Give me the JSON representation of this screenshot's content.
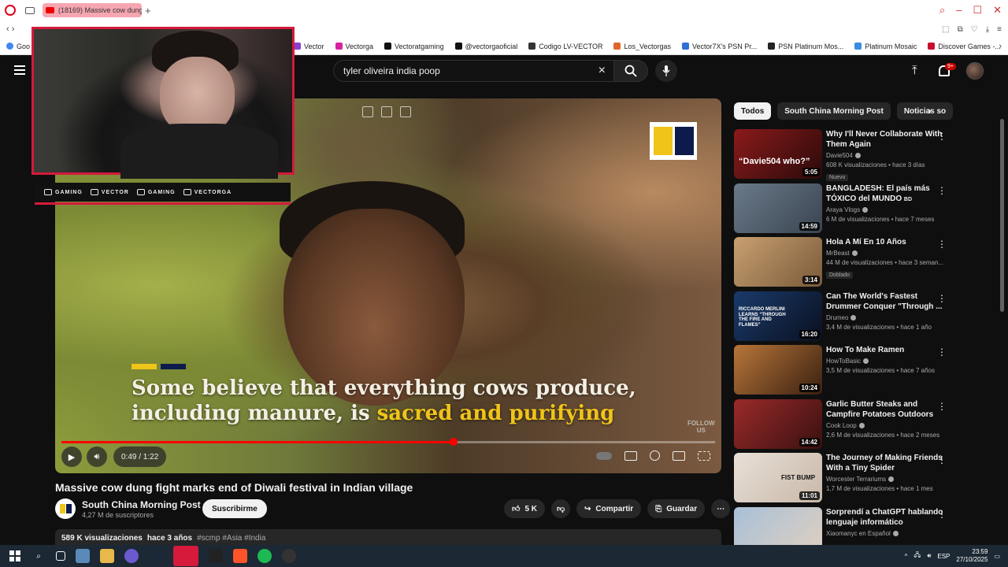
{
  "browser": {
    "tab_title": "(18169) Massive cow dung...",
    "bookmarks_first": "Goo",
    "bookmarks": [
      {
        "label": "Vector",
        "color": "#8a3fd1"
      },
      {
        "label": "Vectorga",
        "color": "#d6249f"
      },
      {
        "label": "Vectoratgaming",
        "color": "#111111"
      },
      {
        "label": "@vectorgaoficial",
        "color": "#111111"
      },
      {
        "label": "Codigo LV-VECTOR",
        "color": "#333333"
      },
      {
        "label": "Los_Vectorgas",
        "color": "#e0652a"
      },
      {
        "label": "Vector7X's PSN Pr...",
        "color": "#2f6fd6"
      },
      {
        "label": "PSN Platinum Mos...",
        "color": "#222222"
      },
      {
        "label": "Platinum Mosaic",
        "color": "#3a8de0"
      },
      {
        "label": "Discover Games -...",
        "color": "#c8102e"
      }
    ]
  },
  "youtube": {
    "search_query": "tyler oliveira india poop",
    "notification_count": "9+",
    "video": {
      "caption_line1": "Some believe that everything cows produce,",
      "caption_line2_a": "including manure, is ",
      "caption_line2_b": "sacred and purifying",
      "follow_text_1": "FOLLOW",
      "follow_text_2": "US",
      "time": "0:49 / 1:22",
      "progress": 0.6
    },
    "title": "Massive cow dung fight marks end of Diwali festival in Indian village",
    "channel": "South China Morning Post",
    "subscribers": "4,27 M de suscriptores",
    "subscribe_label": "Suscribirme",
    "likes": "5 K",
    "share_label": "Compartir",
    "save_label": "Guardar",
    "views": "589 K visualizaciones",
    "date": "hace 3 años",
    "tags": "#scmp #Asia #India",
    "chips": [
      "Todos",
      "South China Morning Post",
      "Noticias so"
    ],
    "recommendations": [
      {
        "title": "Why I'll Never Collaborate With Them Again",
        "channel": "Davie504",
        "meta": "608 K visualizaciones • hace 3 días",
        "duration": "5:05",
        "badge": "Nuevo",
        "thumb_text": "“Davie504 who?”",
        "colors": [
          "#8b1a1a",
          "#2a0a0a"
        ]
      },
      {
        "title": "BANGLADESH: El país más TÓXICO del MUNDO",
        "title_suffix": "BD",
        "channel": "Araya Vlogs",
        "meta": "6 M de visualizaciones • hace 7 meses",
        "duration": "14:59",
        "badge": "",
        "thumb_text": "",
        "colors": [
          "#6a7a8a",
          "#3a4450"
        ]
      },
      {
        "title": "Hola A Mí En 10 Años",
        "channel": "MrBeast",
        "meta": "44 M de visualizaciones • hace 3 seman...",
        "duration": "3:14",
        "badge": "Doblado",
        "thumb_text": "",
        "colors": [
          "#c8a070",
          "#7a5a3a"
        ]
      },
      {
        "title": "Can The World's Fastest Drummer Conquer \"Through ...",
        "channel": "Drumeo",
        "meta": "3,4 M de visualizaciones • hace 1 año",
        "duration": "16:20",
        "badge": "",
        "thumb_text": "RICCARDO MERLINI LEARNS “THROUGH THE FIRE AND FLAMES”",
        "colors": [
          "#1a3a6a",
          "#0a1020"
        ]
      },
      {
        "title": "How To Make Ramen",
        "channel": "HowToBasic",
        "meta": "3,5 M de visualizaciones • hace 7 años",
        "duration": "10:24",
        "badge": "",
        "thumb_text": "",
        "colors": [
          "#b8763a",
          "#3a2010"
        ]
      },
      {
        "title": "Garlic Butter Steaks and Campfire Potatoes Outdoors",
        "channel": "Cook Loop",
        "meta": "2,6 M de visualizaciones • hace 2 meses",
        "duration": "14:42",
        "badge": "",
        "thumb_text": "",
        "colors": [
          "#9a2a2a",
          "#3a1010"
        ]
      },
      {
        "title": "The Journey of Making Friends With a Tiny Spider",
        "channel": "Worcester Terrariums",
        "meta": "1,7 M de visualizaciones • hace 1 mes",
        "duration": "11:01",
        "badge": "",
        "thumb_text": "FIST BUMP",
        "colors": [
          "#e8e0d8",
          "#c8b8a8"
        ]
      },
      {
        "title": "Sorprendí a ChatGPT hablando lenguaje informático",
        "channel": "Xiaomanyc en Español",
        "meta": "",
        "duration": "",
        "badge": "",
        "thumb_text": "",
        "colors": [
          "#a8c0d8",
          "#e0d0c0"
        ]
      }
    ]
  },
  "webcam": {
    "socials": [
      "GAMING",
      "VECTOR",
      "GAMING",
      "VECTORGA"
    ]
  },
  "taskbar": {
    "language": "ESP",
    "time": "23:59",
    "date": "27/10/2025"
  }
}
